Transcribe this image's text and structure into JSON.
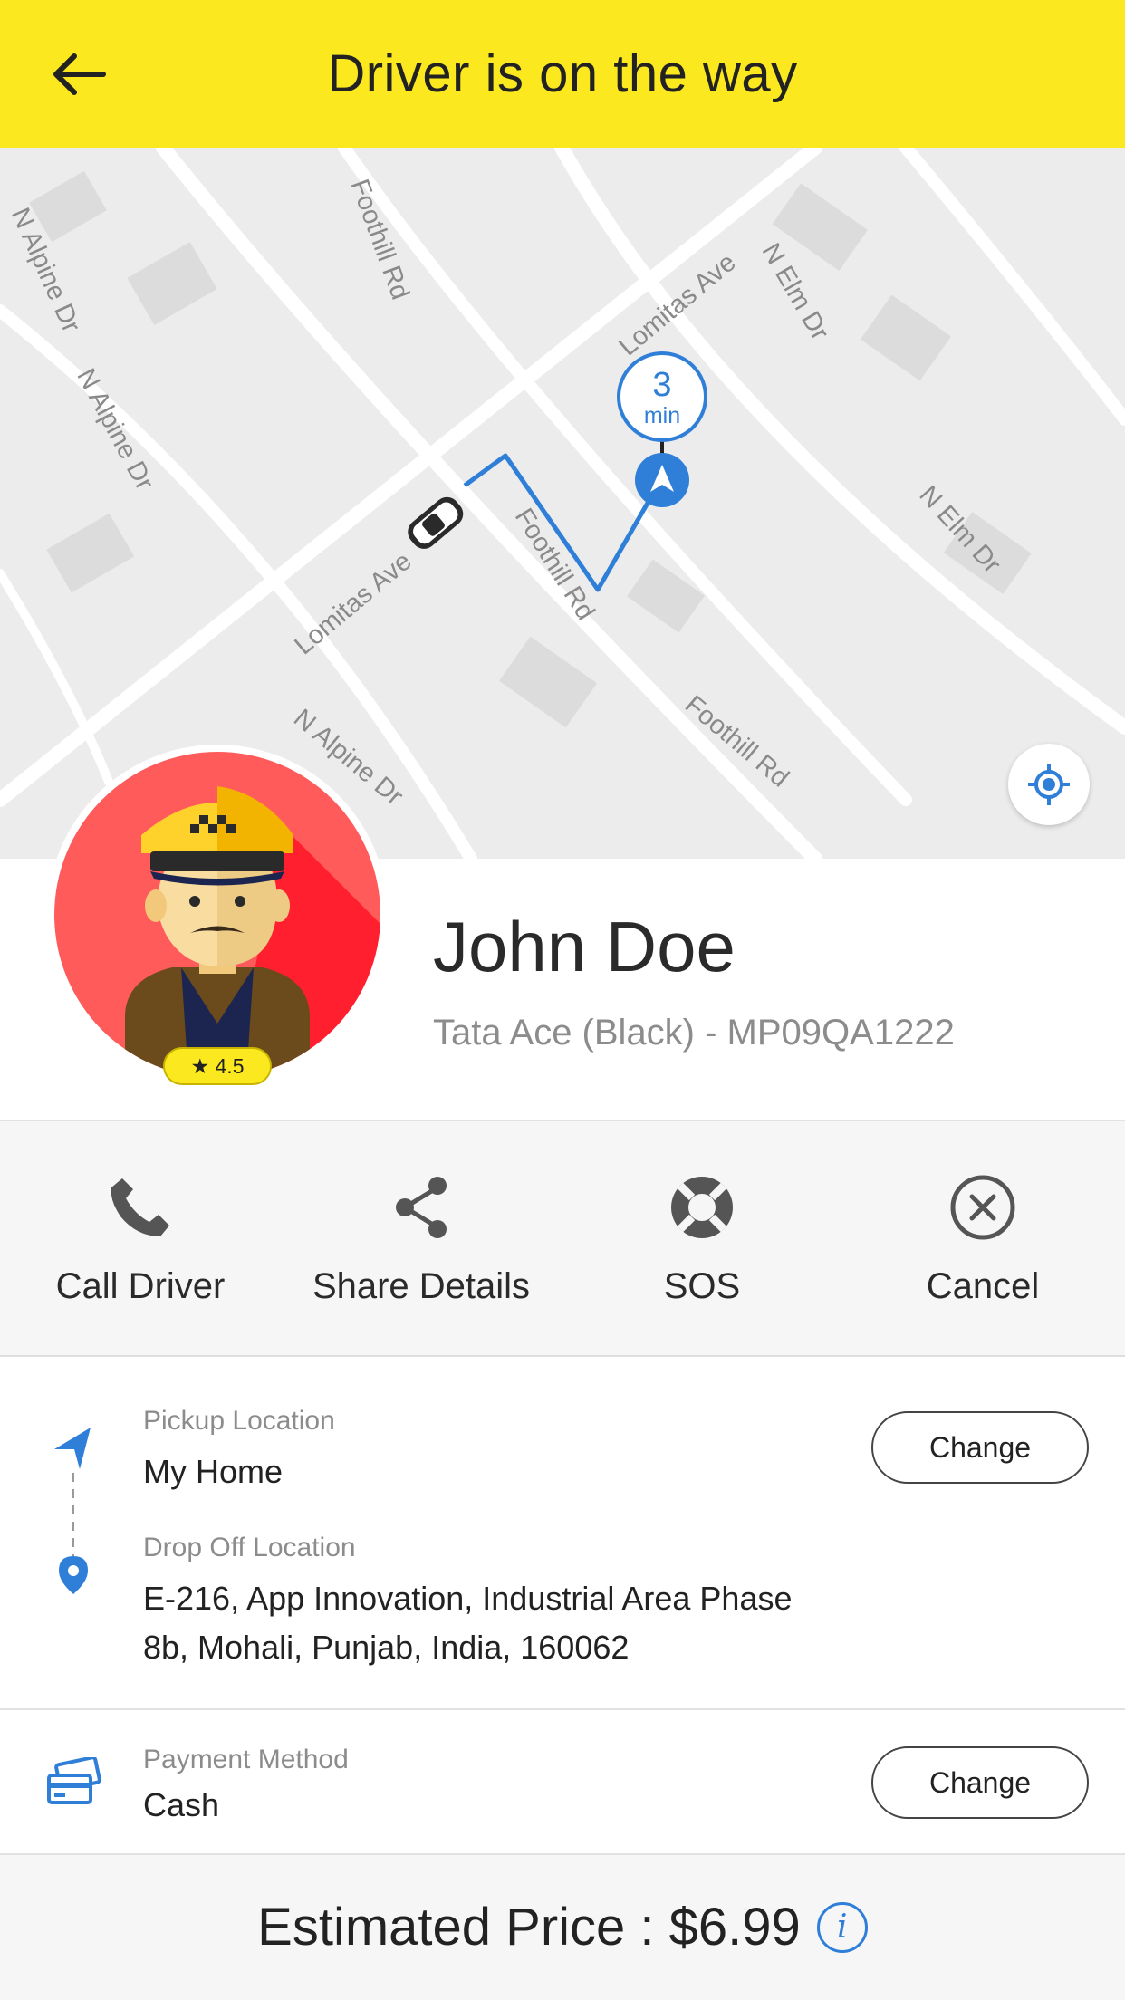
{
  "header": {
    "title": "Driver is on the way",
    "back_icon": "arrow-left-icon",
    "background": "#fbe81e"
  },
  "map": {
    "streets": [
      "N Alpine Dr",
      "N Alpine Dr",
      "N Alpine Dr",
      "Foothill Rd",
      "Foothill Rd",
      "Foothill Rd",
      "Lomitas Ave",
      "Lomitas Ave",
      "N Elm Dr",
      "N Elm Dr"
    ],
    "eta": {
      "value": "3",
      "unit": "min"
    },
    "route_color": "#2f7fd8",
    "locate_icon": "crosshair-icon"
  },
  "driver": {
    "name": "John Doe",
    "vehicle": "Tata Ace (Black) - MP09QA1222",
    "rating": "★ 4.5"
  },
  "actions": [
    {
      "label": "Call Driver",
      "icon": "phone-icon"
    },
    {
      "label": "Share Details",
      "icon": "share-icon"
    },
    {
      "label": "SOS",
      "icon": "lifebuoy-icon"
    },
    {
      "label": "Cancel",
      "icon": "close-circle-icon"
    }
  ],
  "pickup": {
    "caption": "Pickup Location",
    "value": "My Home",
    "change_label": "Change"
  },
  "dropoff": {
    "caption": "Drop Off Location",
    "line1": "E-216, App Innovation, Industrial Area Phase",
    "line2": "8b, Mohali, Punjab, India, 160062"
  },
  "payment": {
    "caption": "Payment Method",
    "value": "Cash",
    "change_label": "Change",
    "icon": "credit-cards-icon"
  },
  "price": {
    "text": "Estimated Price : $6.99",
    "info_glyph": "i"
  }
}
